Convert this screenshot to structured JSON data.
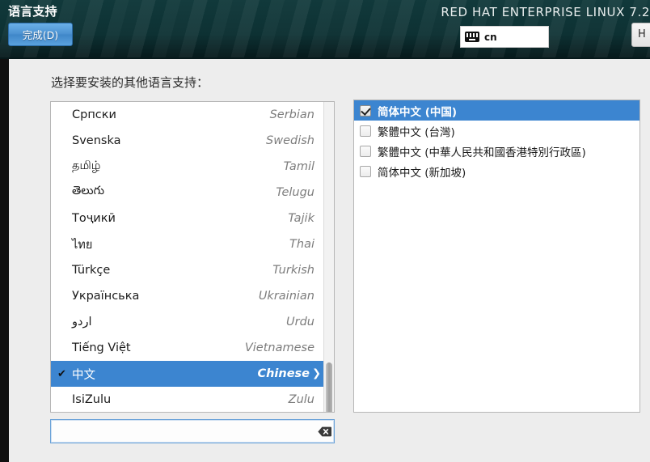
{
  "header": {
    "screen_title": "语言支持",
    "done_button": "完成(D)",
    "product_title": "RED HAT ENTERPRISE LINUX 7.2",
    "keyboard_layout": "cn",
    "keyboard_icon": "keyboard-icon",
    "help_button": "H"
  },
  "main": {
    "prompt": "选择要安装的其他语言支持：",
    "languages": [
      {
        "native": "Српски",
        "english": "Serbian",
        "selected": false
      },
      {
        "native": "Svenska",
        "english": "Swedish",
        "selected": false
      },
      {
        "native": "தமிழ்",
        "english": "Tamil",
        "selected": false
      },
      {
        "native": "తెలుగు",
        "english": "Telugu",
        "selected": false
      },
      {
        "native": "Тоҷикӣ",
        "english": "Tajik",
        "selected": false
      },
      {
        "native": "ไทย",
        "english": "Thai",
        "selected": false
      },
      {
        "native": "Türkçe",
        "english": "Turkish",
        "selected": false
      },
      {
        "native": "Українська",
        "english": "Ukrainian",
        "selected": false
      },
      {
        "native": "اردو",
        "english": "Urdu",
        "selected": false
      },
      {
        "native": "Tiếng Việt",
        "english": "Vietnamese",
        "selected": false
      },
      {
        "native": "中文",
        "english": "Chinese",
        "selected": true
      },
      {
        "native": "IsiZulu",
        "english": "Zulu",
        "selected": false
      }
    ],
    "selected_marks": {
      "check": "✔",
      "chevron": "❯"
    },
    "locales": [
      {
        "label": "简体中文 (中国)",
        "checked": true
      },
      {
        "label": "繁體中文 (台灣)",
        "checked": false
      },
      {
        "label": "繁體中文 (中華人民共和國香港特別行政區)",
        "checked": false
      },
      {
        "label": "简体中文 (新加坡)",
        "checked": false
      }
    ],
    "search": {
      "value": "",
      "placeholder": "",
      "clear_icon": "clear-backspace-icon"
    }
  },
  "colors": {
    "header_bg": "#0c2f31",
    "accent_blue": "#3c85d0",
    "page_bg": "#ededed"
  }
}
